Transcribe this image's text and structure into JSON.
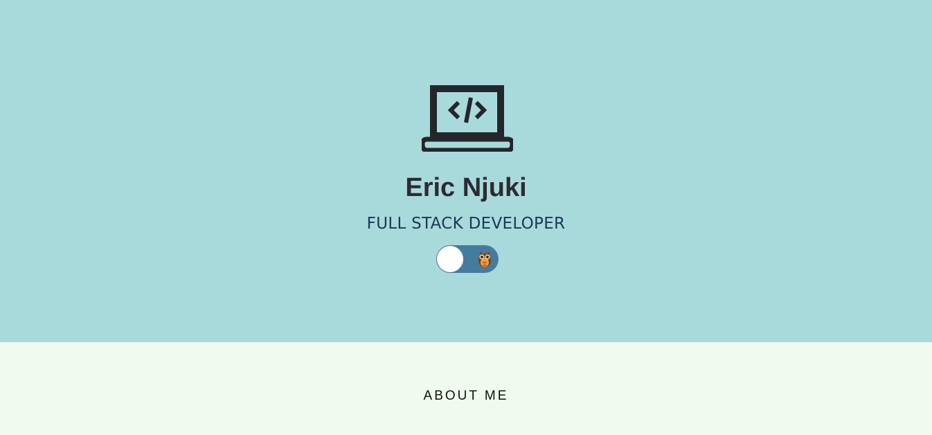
{
  "hero": {
    "logo_icon": "laptop-code-icon",
    "name": "Eric Njuki",
    "role": "FULL STACK DEVELOPER",
    "theme_toggle": {
      "state": "off",
      "icon": "owl-icon"
    }
  },
  "about": {
    "heading": "ABOUT ME"
  },
  "colors": {
    "hero_bg": "#a8dadc",
    "about_bg": "#f1faee",
    "toggle_track": "#457b9d",
    "text_dark": "#2d2a32"
  }
}
